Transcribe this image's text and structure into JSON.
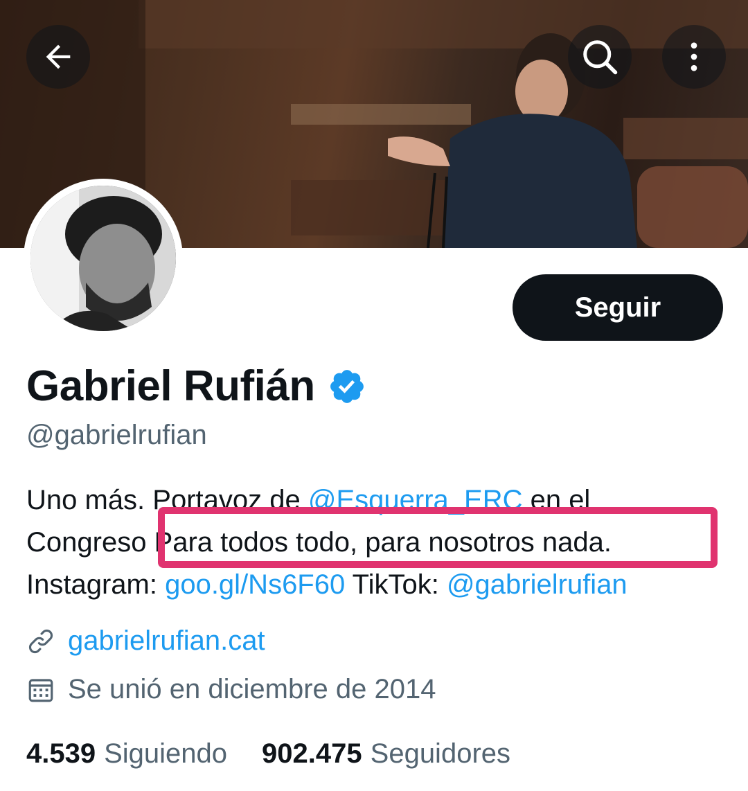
{
  "profile": {
    "name": "Gabriel Rufián",
    "handle": "@gabrielrufian",
    "follow_label": "Seguir",
    "verified": true,
    "bio": {
      "line1_pre": "Uno más. Portavoz de ",
      "line1_mention": "@Esquerra_ERC",
      "line1_post": " en el",
      "line2_pre": "Congreso ",
      "line2_highlight": "Para todos todo, para nosotros nada.",
      "line3_pre": "Instagram: ",
      "line3_link": "goo.gl/Ns6F60",
      "line3_mid": " TikTok: ",
      "line3_mention": "@gabrielrufian"
    },
    "website": "gabrielrufian.cat",
    "joined": "Se unió en diciembre de 2014",
    "following_count": "4.539",
    "following_label": "Siguiendo",
    "followers_count": "902.475",
    "followers_label": "Seguidores"
  },
  "icons": {
    "back": "back-arrow-icon",
    "search": "search-icon",
    "more": "more-vertical-icon",
    "verified": "verified-badge-icon",
    "link": "link-icon",
    "calendar": "calendar-icon"
  },
  "colors": {
    "accent": "#1d9bf0",
    "text": "#0f1419",
    "secondary": "#536471",
    "highlight_border": "#e0336f"
  }
}
